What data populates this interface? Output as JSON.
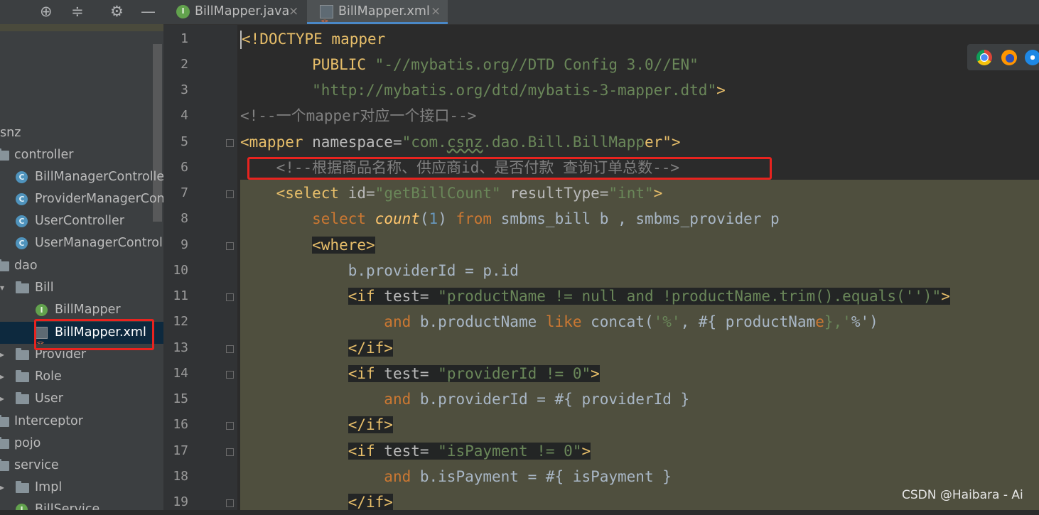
{
  "sidebar": {
    "toolbar": [
      "locate-icon",
      "collapse-icon",
      "gear-icon",
      "minimize-icon"
    ],
    "tree": [
      {
        "label": "snz",
        "icon": "none"
      },
      {
        "label": "controller",
        "icon": "folder-icon"
      },
      {
        "label": "BillManagerController",
        "icon": "class-icon"
      },
      {
        "label": "ProviderManagerController",
        "icon": "class-icon"
      },
      {
        "label": "UserController",
        "icon": "class-icon"
      },
      {
        "label": "UserManagerController",
        "icon": "class-icon"
      },
      {
        "label": "dao",
        "icon": "folder-icon"
      },
      {
        "label": "Bill",
        "icon": "folder-icon"
      },
      {
        "label": "BillMapper",
        "icon": "interface-icon"
      },
      {
        "label": "BillMapper.xml",
        "icon": "xml-file-icon",
        "selected": true
      },
      {
        "label": "Provider",
        "icon": "folder-icon"
      },
      {
        "label": "Role",
        "icon": "folder-icon"
      },
      {
        "label": "User",
        "icon": "folder-icon"
      },
      {
        "label": "Interceptor",
        "icon": "none"
      },
      {
        "label": "pojo",
        "icon": "none"
      },
      {
        "label": "service",
        "icon": "none"
      },
      {
        "label": "Impl",
        "icon": "folder-icon"
      },
      {
        "label": "BillService",
        "icon": "interface-icon"
      }
    ]
  },
  "tabs": [
    {
      "label": "BillMapper.java",
      "icon": "interface-icon",
      "active": false
    },
    {
      "label": "BillMapper.xml",
      "icon": "xml-file-icon",
      "active": true
    }
  ],
  "editor": {
    "line_numbers": [
      "1",
      "2",
      "3",
      "4",
      "5",
      "6",
      "7",
      "8",
      "9",
      "10",
      "11",
      "12",
      "13",
      "14",
      "15",
      "16",
      "17",
      "18",
      "19"
    ],
    "lines": [
      {
        "text": "<!DOCTYPE mapper"
      },
      {
        "text": "        PUBLIC \"-//mybatis.org//DTD Config 3.0//EN\""
      },
      {
        "text": "        \"http://mybatis.org/dtd/mybatis-3-mapper.dtd\">"
      },
      {
        "text": "<!--一个mapper对应一个接口-->"
      },
      {
        "text": "<mapper namespace=\"com.csnz.dao.Bill.BillMapper\">"
      },
      {
        "text": "    <!--根据商品名称、供应商id、是否付款 查询订单总数-->"
      },
      {
        "text": "    <select id=\"getBillCount\" resultType=\"int\">"
      },
      {
        "text": "        select count(1) from smbms_bill b , smbms_provider p"
      },
      {
        "text": "        <where>"
      },
      {
        "text": "            b.providerId = p.id"
      },
      {
        "text": "            <if test= \"productName != null and !productName.trim().equals('')\">"
      },
      {
        "text": "                and b.productName like concat('%', #{ productName},'%')"
      },
      {
        "text": "            </if>"
      },
      {
        "text": "            <if test= \"providerId != 0\">"
      },
      {
        "text": "                and b.providerId = #{ providerId }"
      },
      {
        "text": "            </if>"
      },
      {
        "text": "            <if test= \"isPayment != 0\">"
      },
      {
        "text": "                and b.isPayment = #{ isPayment }"
      },
      {
        "text": "            </if>"
      }
    ]
  },
  "browser_icons": [
    "chrome-icon",
    "firefox-icon",
    "safari-icon"
  ],
  "watermark": "CSDN @Haibara - Ai",
  "colors": {
    "background": "#2b2b2b",
    "sidebar": "#3c3f41",
    "tag": "#e8bf6a",
    "string": "#6a8759",
    "comment": "#808080",
    "keyword": "#cc7832",
    "highlight_box": "#e8231f"
  }
}
